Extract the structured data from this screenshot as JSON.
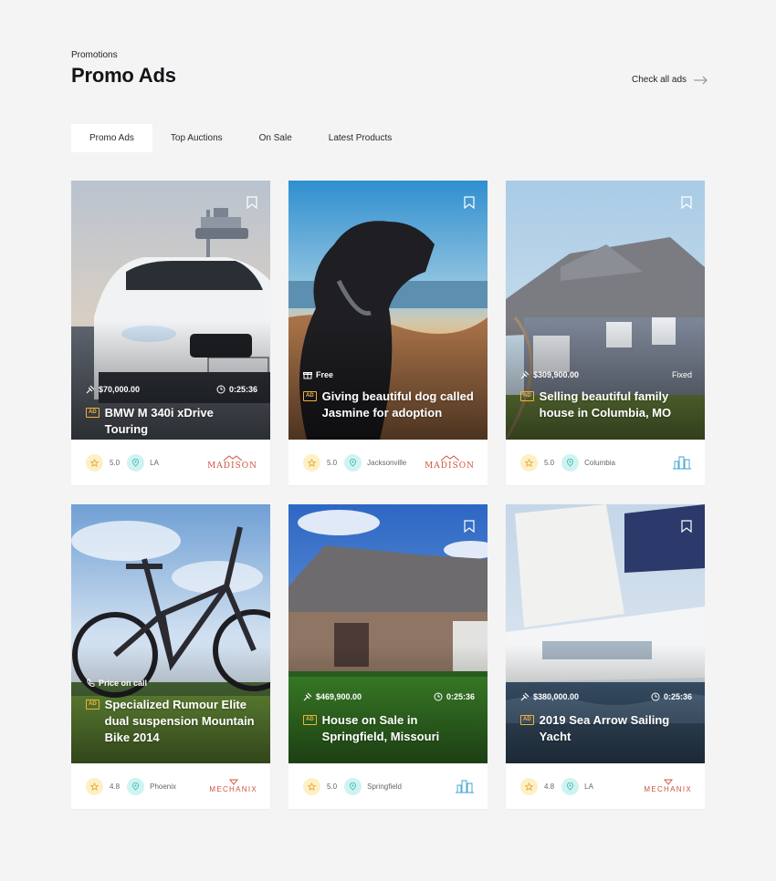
{
  "header": {
    "eyebrow": "Promotions",
    "title": "Promo Ads",
    "check_all": "Check all ads"
  },
  "tabs": [
    {
      "label": "Promo Ads",
      "active": true
    },
    {
      "label": "Top Auctions",
      "active": false
    },
    {
      "label": "On Sale",
      "active": false
    },
    {
      "label": "Latest Products",
      "active": false
    }
  ],
  "colors": {
    "background": "#f4f4f5",
    "accent_badge": "#f2b23a",
    "star_bg": "#fdf0c5",
    "pin_bg": "#cff3f1",
    "logo_red": "#d0553f",
    "logo_blue": "#3aa4cc"
  },
  "cards": [
    {
      "title": "BMW M 340i xDrive Touring",
      "price": "$70,000.00",
      "price_icon": "auction-gavel-icon",
      "time": "0:25:36",
      "badge": "AD",
      "rating": "5.0",
      "location": "LA",
      "logo": {
        "name": "MADISON",
        "type": "madison"
      },
      "image": "white BMW car in front of control tower"
    },
    {
      "title": "Giving beautiful dog called Jasmine for adoption",
      "price": "Free",
      "price_icon": "gift-icon",
      "time": "",
      "badge": "AD",
      "rating": "5.0",
      "location": "Jacksonville",
      "logo": {
        "name": "MADISON",
        "type": "madison"
      },
      "image": "black labrador dog by the lake"
    },
    {
      "title": "Selling beautiful family house in Columbia, MO",
      "price": "$309,900.00",
      "price_icon": "auction-gavel-icon",
      "time": "Fixed",
      "badge": "AD",
      "rating": "5.0",
      "location": "Columbia",
      "logo": {
        "name": "",
        "type": "tower"
      },
      "image": "grey family house with porch"
    },
    {
      "title": "Specialized Rumour Elite dual suspension Mountain Bike 2014",
      "price": "Price on call",
      "price_icon": "phone-icon",
      "time": "",
      "badge": "AD",
      "rating": "4.8",
      "location": "Phoenix",
      "logo": {
        "name": "MECHANIX",
        "type": "mechanix"
      },
      "image": "mountain bike on grass"
    },
    {
      "title": "House on Sale in Springfield, Missouri",
      "price": "$469,900.00",
      "price_icon": "auction-gavel-icon",
      "time": "0:25:36",
      "badge": "AD",
      "rating": "5.0",
      "location": "Springfield",
      "logo": {
        "name": "",
        "type": "tower"
      },
      "image": "brick house with lawn"
    },
    {
      "title": "2019 Sea Arrow Sailing Yacht",
      "price": "$380,000.00",
      "price_icon": "auction-gavel-icon",
      "time": "0:25:36",
      "badge": "AD",
      "rating": "4.8",
      "location": "LA",
      "logo": {
        "name": "MECHANIX",
        "type": "mechanix"
      },
      "image": "white sailing yacht at sea"
    }
  ]
}
